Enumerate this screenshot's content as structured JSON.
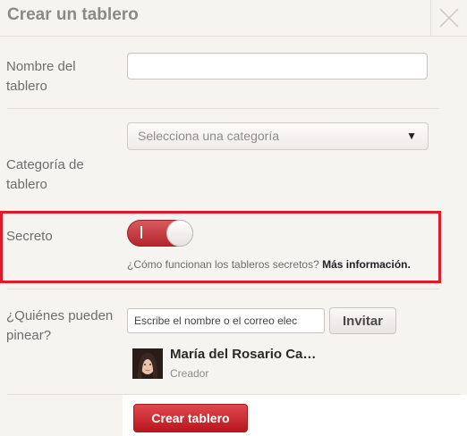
{
  "dialog": {
    "title": "Crear un tablero"
  },
  "form": {
    "name_label_line1": "Nombre del",
    "name_label_line2": "tablero",
    "name_value": "",
    "category_label_line1": "Categoría de",
    "category_label_line2": "tablero",
    "category_selected": "Selecciona una categoría",
    "category_arrow": "▼",
    "secret_label": "Secreto",
    "secret_toggle_on": true,
    "secret_toggle_mark": "|",
    "secret_help_text": "¿Cómo funcionan los tableros secretos?",
    "secret_help_link": "Más información.",
    "pinners_label_line1": "¿Quiénes pueden",
    "pinners_label_line2": "pinear?",
    "invite_placeholder": "Escribe el nombre o el correo elec",
    "invite_button": "Invitar",
    "collaborator": {
      "name": "María del Rosario Ca…",
      "role": "Creador"
    }
  },
  "footer": {
    "create_button": "Crear tablero"
  },
  "colors": {
    "accent": "#cb2027",
    "highlight_border": "#e01a2a",
    "background": "#f6f4f1"
  },
  "icons": {
    "close": "close-icon",
    "dropdown": "chevron-down-icon"
  }
}
